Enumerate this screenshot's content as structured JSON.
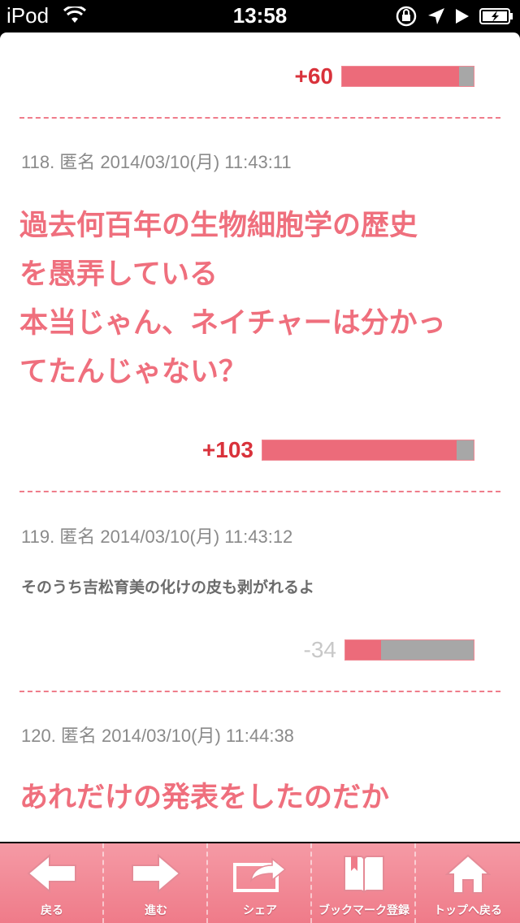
{
  "status_bar": {
    "carrier": "iPod",
    "time": "13:58"
  },
  "votes": {
    "top": {
      "label": "+60",
      "ratio": 0.89
    },
    "c118": {
      "label": "+103",
      "ratio": 0.92
    },
    "c119": {
      "label": "-34",
      "ratio": 0.28
    }
  },
  "comments": [
    {
      "meta": "118. 匿名 2014/03/10(月) 11:43:11",
      "lines": [
        "過去何百年の生物細胞学の歴史",
        "を愚弄している",
        "本当じゃん、ネイチャーは分かっ",
        "てたんじゃない？"
      ]
    },
    {
      "meta": "119. 匿名 2014/03/10(月) 11:43:12",
      "text": "そのうち吉松育美の化けの皮も剥がれるよ"
    },
    {
      "meta": "120. 匿名 2014/03/10(月) 11:44:38",
      "lines": [
        "あれだけの発表をしたのだか"
      ]
    }
  ],
  "toolbar": {
    "back": "戻る",
    "forward": "進む",
    "share": "シェア",
    "bookmark": "ブックマーク登録",
    "top": "トップへ戻る"
  },
  "colors": {
    "accent": "#ef6f7d",
    "positive": "#d9323b",
    "bar_fill": "#ec6b7a",
    "bar_bg": "#a7a7a7"
  }
}
